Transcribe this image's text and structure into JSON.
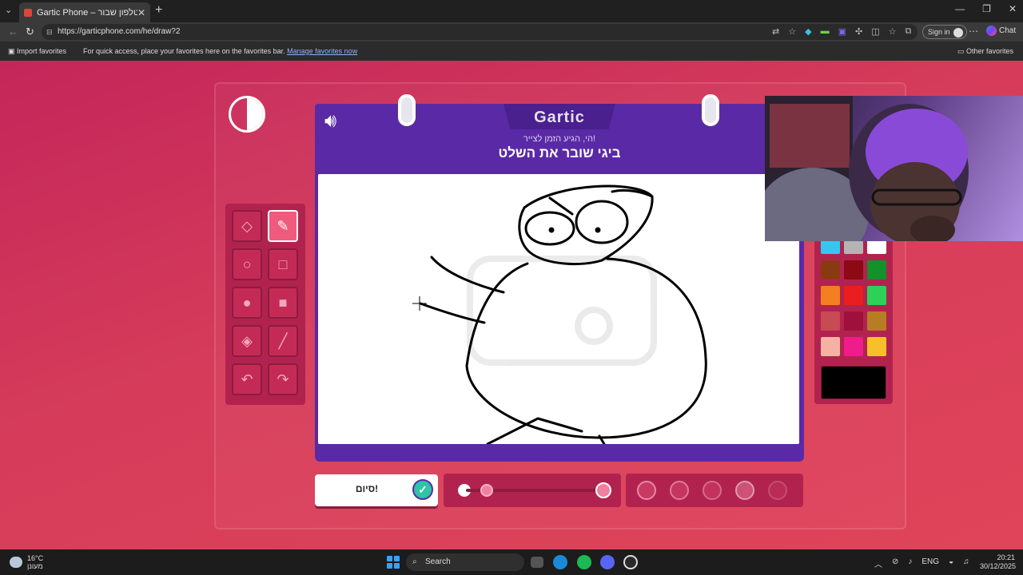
{
  "browser": {
    "tab_title": "Gartic Phone – טלפון שבור",
    "tab_close": "✕",
    "new_tab": "+",
    "url": "https://garticphone.com/he/draw?2",
    "sign_in": "Sign in",
    "chat": "Chat",
    "favorites": {
      "import": "Import favorites",
      "message": "For quick access, place your favorites here on the favorites bar.",
      "manage_link": "Manage favorites now",
      "other": "Other favorites"
    }
  },
  "game": {
    "logo": "Gartic",
    "subprompt": "הי, הגיע הזמן לצייר!",
    "prompt": "ביגי שובר את השלט",
    "done_label": "סיום!",
    "done_check": "✓",
    "tools": [
      {
        "name": "eraser-tool",
        "icon": "eraser-icon",
        "glyph": "◇",
        "active": false
      },
      {
        "name": "pen-tool",
        "icon": "pen-icon",
        "glyph": "✎",
        "active": true
      },
      {
        "name": "ellipse-outline-tool",
        "icon": "circle-outline-icon",
        "glyph": "○",
        "active": false
      },
      {
        "name": "rect-outline-tool",
        "icon": "square-outline-icon",
        "glyph": "□",
        "active": false
      },
      {
        "name": "ellipse-fill-tool",
        "icon": "circle-filled-icon",
        "glyph": "●",
        "active": false
      },
      {
        "name": "rect-fill-tool",
        "icon": "square-filled-icon",
        "glyph": "■",
        "active": false
      },
      {
        "name": "bucket-tool",
        "icon": "bucket-icon",
        "glyph": "◈",
        "active": false
      },
      {
        "name": "line-tool",
        "icon": "line-icon",
        "glyph": "╱",
        "active": false
      },
      {
        "name": "undo-tool",
        "icon": "undo-icon",
        "glyph": "↶",
        "active": false
      },
      {
        "name": "redo-tool",
        "icon": "redo-icon",
        "glyph": "↷",
        "active": false
      }
    ],
    "palette": [
      "#34c8f0",
      "#b4b4b4",
      "#ffffff",
      "#8a3a12",
      "#8c0a14",
      "#11922a",
      "#f47f20",
      "#ea1e1e",
      "#2ed158",
      "#c84a55",
      "#a0103c",
      "#b87d24",
      "#f4b2a4",
      "#ef1c8c",
      "#f7c02a"
    ],
    "selected_color": "#000000",
    "brush_size_fraction": 0.15,
    "opacity_levels": 5,
    "opacity_selected_index": 3
  },
  "taskbar": {
    "temp": "16°C",
    "weather_text": "מעונן",
    "search": "Search",
    "lang": "ENG",
    "time": "20:21",
    "date": "30/12/2025"
  }
}
